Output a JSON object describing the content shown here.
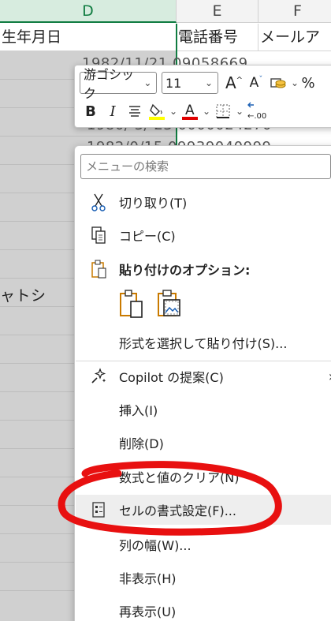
{
  "spreadsheet": {
    "columns": [
      {
        "letter": "D",
        "header": "生年月日",
        "selected": true
      },
      {
        "letter": "E",
        "header": "電話番号"
      },
      {
        "letter": "F",
        "header": "メールア"
      }
    ],
    "peek_rows": [
      "1982/11/21 09058669",
      "1980/ 3/ 23 0000024270",
      "1982/0/15 09939040999"
    ],
    "side_text": "ャトシ"
  },
  "mini_toolbar": {
    "font_name": "游ゴシック",
    "font_size": "11",
    "grow_font": "A",
    "shrink_font": "A",
    "bold": "B",
    "italic": "I",
    "font_color_letter": "A",
    "highlight_color": "#ffff00",
    "font_color": "#e00000",
    "decimal_label": ".00"
  },
  "context_menu": {
    "search_placeholder": "メニューの検索",
    "items": [
      {
        "label": "切り取り(T)",
        "icon": "scissors-icon"
      },
      {
        "label": "コピー(C)",
        "icon": "copy-icon"
      },
      {
        "label": "貼り付けのオプション:",
        "icon": "clipboard-icon"
      },
      {
        "label": "形式を選択して貼り付け(S)...",
        "icon": ""
      },
      {
        "label": "Copilot の提案(C)",
        "icon": "copilot-sparkle-icon"
      },
      {
        "label": "挿入(I)",
        "icon": ""
      },
      {
        "label": "削除(D)",
        "icon": ""
      },
      {
        "label": "数式と値のクリア(N)",
        "icon": ""
      },
      {
        "label": "セルの書式設定(F)...",
        "icon": "format-cells-icon"
      },
      {
        "label": "列の幅(W)...",
        "icon": ""
      },
      {
        "label": "非表示(H)",
        "icon": ""
      },
      {
        "label": "再表示(U)",
        "icon": ""
      }
    ],
    "paste_options": [
      "paste-icon",
      "paste-picture-icon"
    ],
    "submenu_arrow": "›"
  },
  "annotation_color": "#e81010"
}
